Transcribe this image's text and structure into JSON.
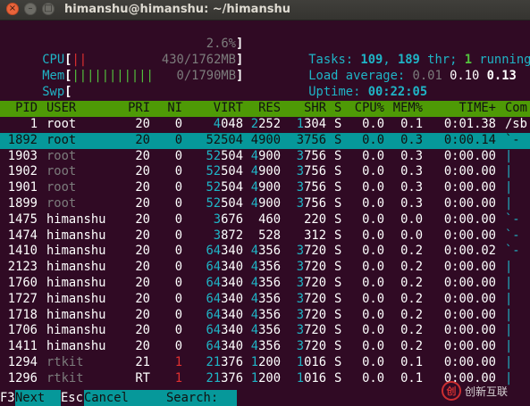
{
  "window": {
    "title": "himanshu@himanshu: ~/himanshu",
    "close_glyph": "×",
    "minimize_glyph": "–",
    "maximize_glyph": "□"
  },
  "meters": {
    "cpu": {
      "label": "CPU",
      "open": "[",
      "bars": "||",
      "value": "2.6%",
      "close": "]"
    },
    "mem": {
      "label": "Mem",
      "open": "[",
      "bars": "|||||||||||",
      "value": "430/1762MB",
      "close": "]"
    },
    "swp": {
      "label": "Swp",
      "open": "[",
      "bars": "",
      "value": "0/1790MB",
      "close": "]"
    }
  },
  "summary": {
    "tasks_label": "Tasks: ",
    "tasks": "109",
    "sep": ", ",
    "threads": "189",
    "thr_label": " thr; ",
    "running": "1",
    "running_label": " running",
    "load_label": "Load average: ",
    "load1": "0.01",
    "load5": "0.10",
    "load15": "0.13",
    "uptime_label": "Uptime: ",
    "uptime": "00:22:05"
  },
  "columns": [
    "PID",
    "USER",
    "PRI",
    "NI",
    "VIRT",
    "RES",
    "SHR",
    "S",
    "CPU%",
    "MEM%",
    "TIME+",
    "Com"
  ],
  "processes": [
    {
      "pid": "1",
      "user": "root",
      "pri": "20",
      "ni": "0",
      "virt_hi": "4",
      "virt_lo": "048",
      "res_hi": "2",
      "res_lo": "252",
      "shr_hi": "1",
      "shr_lo": "304",
      "s": "S",
      "cpu": "0.0",
      "mem": "0.1",
      "time": "0:01.38",
      "cmd": "/sb"
    },
    {
      "pid": "1892",
      "user": "root",
      "pri": "20",
      "ni": "0",
      "virt_hi": "52",
      "virt_lo": "504",
      "res_hi": "4",
      "res_lo": "900",
      "shr_hi": "3",
      "shr_lo": "756",
      "s": "S",
      "cpu": "0.0",
      "mem": "0.3",
      "time": "0:00.14",
      "cmd": "`-"
    },
    {
      "pid": "1903",
      "user": "root",
      "pri": "20",
      "ni": "0",
      "virt_hi": "52",
      "virt_lo": "504",
      "res_hi": "4",
      "res_lo": "900",
      "shr_hi": "3",
      "shr_lo": "756",
      "s": "S",
      "cpu": "0.0",
      "mem": "0.3",
      "time": "0:00.00",
      "cmd": "|"
    },
    {
      "pid": "1902",
      "user": "root",
      "pri": "20",
      "ni": "0",
      "virt_hi": "52",
      "virt_lo": "504",
      "res_hi": "4",
      "res_lo": "900",
      "shr_hi": "3",
      "shr_lo": "756",
      "s": "S",
      "cpu": "0.0",
      "mem": "0.3",
      "time": "0:00.00",
      "cmd": "|"
    },
    {
      "pid": "1901",
      "user": "root",
      "pri": "20",
      "ni": "0",
      "virt_hi": "52",
      "virt_lo": "504",
      "res_hi": "4",
      "res_lo": "900",
      "shr_hi": "3",
      "shr_lo": "756",
      "s": "S",
      "cpu": "0.0",
      "mem": "0.3",
      "time": "0:00.00",
      "cmd": "|"
    },
    {
      "pid": "1899",
      "user": "root",
      "pri": "20",
      "ni": "0",
      "virt_hi": "52",
      "virt_lo": "504",
      "res_hi": "4",
      "res_lo": "900",
      "shr_hi": "3",
      "shr_lo": "756",
      "s": "S",
      "cpu": "0.0",
      "mem": "0.3",
      "time": "0:00.00",
      "cmd": "|"
    },
    {
      "pid": "1475",
      "user": "himanshu",
      "pri": "20",
      "ni": "0",
      "virt_hi": "3",
      "virt_lo": "676",
      "res_hi": "",
      "res_lo": "460",
      "shr_hi": "",
      "shr_lo": "220",
      "s": "S",
      "cpu": "0.0",
      "mem": "0.0",
      "time": "0:00.00",
      "cmd": "`-"
    },
    {
      "pid": "1474",
      "user": "himanshu",
      "pri": "20",
      "ni": "0",
      "virt_hi": "3",
      "virt_lo": "872",
      "res_hi": "",
      "res_lo": "528",
      "shr_hi": "",
      "shr_lo": "312",
      "s": "S",
      "cpu": "0.0",
      "mem": "0.0",
      "time": "0:00.00",
      "cmd": "`-"
    },
    {
      "pid": "1410",
      "user": "himanshu",
      "pri": "20",
      "ni": "0",
      "virt_hi": "64",
      "virt_lo": "340",
      "res_hi": "4",
      "res_lo": "356",
      "shr_hi": "3",
      "shr_lo": "720",
      "s": "S",
      "cpu": "0.0",
      "mem": "0.2",
      "time": "0:00.02",
      "cmd": "`-"
    },
    {
      "pid": "2123",
      "user": "himanshu",
      "pri": "20",
      "ni": "0",
      "virt_hi": "64",
      "virt_lo": "340",
      "res_hi": "4",
      "res_lo": "356",
      "shr_hi": "3",
      "shr_lo": "720",
      "s": "S",
      "cpu": "0.0",
      "mem": "0.2",
      "time": "0:00.00",
      "cmd": "|"
    },
    {
      "pid": "1760",
      "user": "himanshu",
      "pri": "20",
      "ni": "0",
      "virt_hi": "64",
      "virt_lo": "340",
      "res_hi": "4",
      "res_lo": "356",
      "shr_hi": "3",
      "shr_lo": "720",
      "s": "S",
      "cpu": "0.0",
      "mem": "0.2",
      "time": "0:00.00",
      "cmd": "|"
    },
    {
      "pid": "1727",
      "user": "himanshu",
      "pri": "20",
      "ni": "0",
      "virt_hi": "64",
      "virt_lo": "340",
      "res_hi": "4",
      "res_lo": "356",
      "shr_hi": "3",
      "shr_lo": "720",
      "s": "S",
      "cpu": "0.0",
      "mem": "0.2",
      "time": "0:00.00",
      "cmd": "|"
    },
    {
      "pid": "1718",
      "user": "himanshu",
      "pri": "20",
      "ni": "0",
      "virt_hi": "64",
      "virt_lo": "340",
      "res_hi": "4",
      "res_lo": "356",
      "shr_hi": "3",
      "shr_lo": "720",
      "s": "S",
      "cpu": "0.0",
      "mem": "0.2",
      "time": "0:00.00",
      "cmd": "|"
    },
    {
      "pid": "1706",
      "user": "himanshu",
      "pri": "20",
      "ni": "0",
      "virt_hi": "64",
      "virt_lo": "340",
      "res_hi": "4",
      "res_lo": "356",
      "shr_hi": "3",
      "shr_lo": "720",
      "s": "S",
      "cpu": "0.0",
      "mem": "0.2",
      "time": "0:00.00",
      "cmd": "|"
    },
    {
      "pid": "1411",
      "user": "himanshu",
      "pri": "20",
      "ni": "0",
      "virt_hi": "64",
      "virt_lo": "340",
      "res_hi": "4",
      "res_lo": "356",
      "shr_hi": "3",
      "shr_lo": "720",
      "s": "S",
      "cpu": "0.0",
      "mem": "0.2",
      "time": "0:00.00",
      "cmd": "|"
    },
    {
      "pid": "1294",
      "user": "rtkit",
      "pri": "21",
      "ni": "1",
      "virt_hi": "21",
      "virt_lo": "376",
      "res_hi": "1",
      "res_lo": "200",
      "shr_hi": "1",
      "shr_lo": "016",
      "s": "S",
      "cpu": "0.0",
      "mem": "0.1",
      "time": "0:00.00",
      "cmd": "|"
    },
    {
      "pid": "1296",
      "user": "rtkit",
      "pri": "RT",
      "ni": "1",
      "virt_hi": "21",
      "virt_lo": "376",
      "res_hi": "1",
      "res_lo": "200",
      "shr_hi": "1",
      "shr_lo": "016",
      "s": "S",
      "cpu": "0.0",
      "mem": "0.1",
      "time": "0:00.00",
      "cmd": "|"
    }
  ],
  "footer": {
    "f3_key": "F3",
    "f3_label": "Next",
    "esc_key": "Esc",
    "esc_label": "Cancel",
    "search_label": "Search: ",
    "search_value": ""
  },
  "watermark": {
    "logo_glyph": "创",
    "text": "创新互联"
  },
  "colors": {
    "background": "#300a24",
    "header_bar": "#4e9a06",
    "selection": "#06989a",
    "cyan": "#1fb4c6",
    "nice_red": "#e03030"
  }
}
